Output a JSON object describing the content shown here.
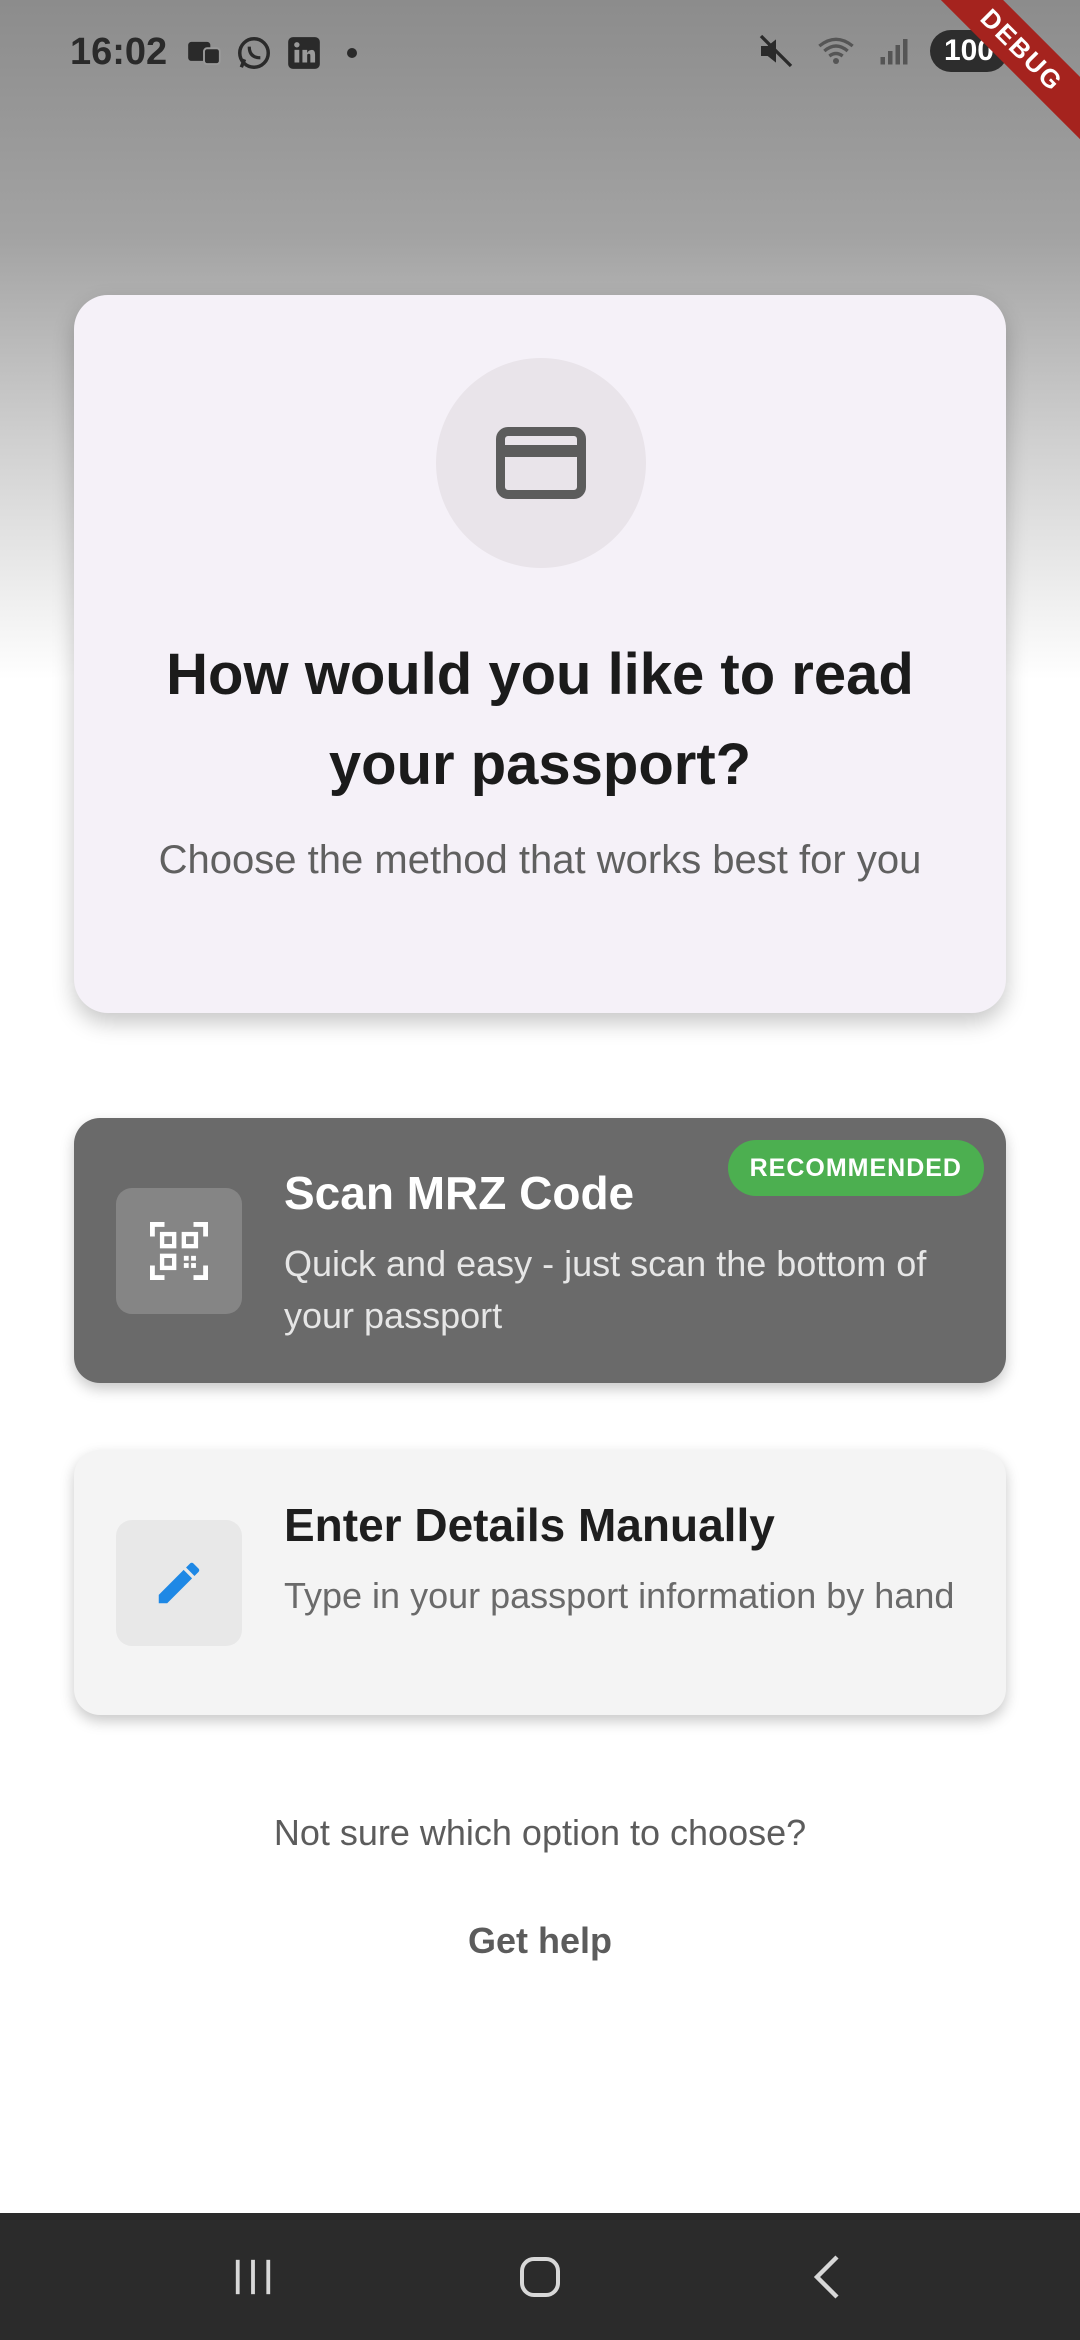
{
  "status_bar": {
    "time": "16:02",
    "left_icons": [
      "notification-icon",
      "whatsapp-icon",
      "linkedin-icon"
    ],
    "right_icons": [
      "mute-icon",
      "wifi-icon",
      "signal-icon"
    ],
    "battery": "100"
  },
  "debug_banner": "DEBUG",
  "header": {
    "icon": "credit-card-icon",
    "title": "How would you like to read your passport?",
    "subtitle": "Choose the method that works best for you"
  },
  "options": [
    {
      "icon": "qr-code-scanner-icon",
      "title": "Scan MRZ Code",
      "description": "Quick and easy - just scan the bottom of your passport",
      "badge": "RECOMMENDED",
      "selected": true
    },
    {
      "icon": "pencil-icon",
      "title": "Enter Details Manually",
      "description": "Type in your passport information by hand",
      "selected": false
    }
  ],
  "help": {
    "question": "Not sure which option to choose?",
    "link_label": "Get help"
  },
  "nav_bar": [
    "recent-apps-icon",
    "home-icon",
    "back-icon"
  ],
  "colors": {
    "header_card_bg": "#f5f1f8",
    "selected_card_bg": "#6a6a6a",
    "unselected_card_bg": "#f4f4f4",
    "badge_green": "#4caf50",
    "pencil_blue": "#1e88e5",
    "debug_red": "#a5231e"
  }
}
